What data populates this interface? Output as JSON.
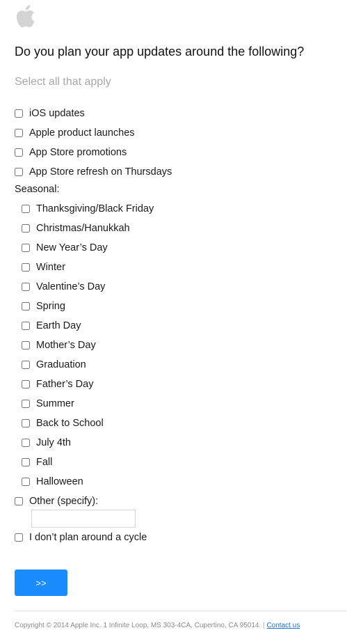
{
  "brand": {
    "logo_icon": "apple-logo-icon",
    "logo_color": "#d4d4d4"
  },
  "question": "Do you plan your app updates around the following?",
  "hint": "Select all that apply",
  "options": [
    "iOS updates",
    "Apple product launches",
    "App Store promotions",
    "App Store refresh on Thursdays"
  ],
  "seasonal": {
    "label": "Seasonal:",
    "items": [
      "Thanksgiving/Black Friday",
      "Christmas/Hanukkah",
      "New Year’s Day",
      "Winter",
      "Valentine’s Day",
      "Spring",
      "Earth Day",
      "Mother’s Day",
      "Graduation",
      "Father’s Day",
      "Summer",
      "Back to School",
      "July 4th",
      "Fall",
      "Halloween"
    ]
  },
  "other": {
    "label": "Other (specify):",
    "value": "",
    "placeholder": ""
  },
  "none_option": "I don’t plan around a cycle",
  "next_button": ">>",
  "colors": {
    "accent": "#1a8cff",
    "hint": "#a8a8a8",
    "link": "#1a73d9"
  },
  "footer": {
    "copyright": "Copyright © 2014 Apple Inc. 1 Infinite Loop, MS 303-4CA, Cupertino, CA 95014.",
    "separator": "|",
    "contact_link": "Contact us"
  }
}
